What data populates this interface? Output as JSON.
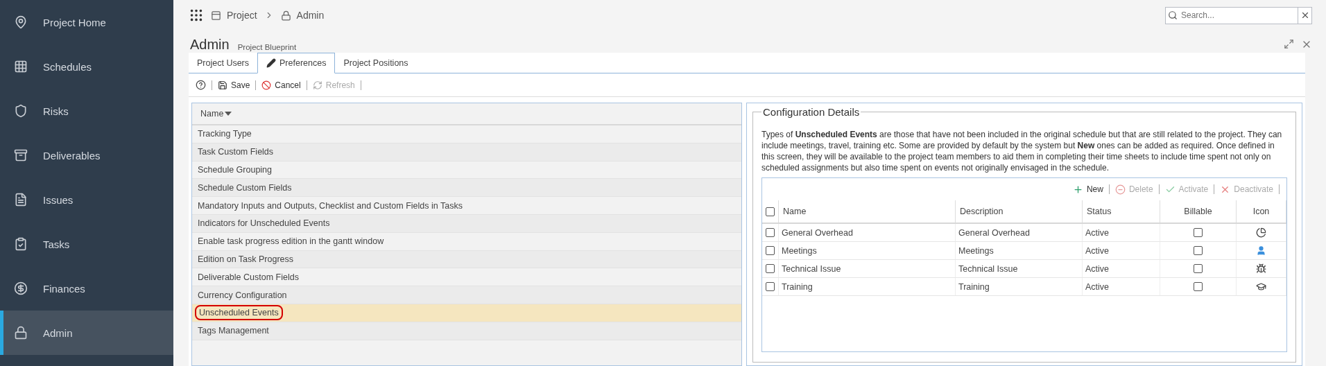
{
  "sidebar": {
    "items": [
      {
        "label": "Project Home",
        "selected": false
      },
      {
        "label": "Schedules",
        "selected": false
      },
      {
        "label": "Risks",
        "selected": false
      },
      {
        "label": "Deliverables",
        "selected": false
      },
      {
        "label": "Issues",
        "selected": false
      },
      {
        "label": "Tasks",
        "selected": false
      },
      {
        "label": "Finances",
        "selected": false
      },
      {
        "label": "Admin",
        "selected": true
      }
    ]
  },
  "breadcrumb": [
    "Project",
    "Admin"
  ],
  "search": {
    "placeholder": "Search..."
  },
  "page": {
    "title": "Admin",
    "subtitle": "Project Blueprint"
  },
  "tabs": [
    {
      "label": "Project Users",
      "selected": false
    },
    {
      "label": "Preferences",
      "selected": true
    },
    {
      "label": "Project Positions",
      "selected": false
    }
  ],
  "toolbar": [
    {
      "label": "Save",
      "disabled": false
    },
    {
      "label": "Cancel",
      "disabled": false
    },
    {
      "label": "Refresh",
      "disabled": true
    }
  ],
  "preferences": {
    "column": "Name",
    "items": [
      {
        "label": "Tracking Type",
        "selected": false,
        "circled": false
      },
      {
        "label": "Task Custom Fields",
        "selected": false,
        "circled": false
      },
      {
        "label": "Schedule Grouping",
        "selected": false,
        "circled": false
      },
      {
        "label": "Schedule Custom Fields",
        "selected": false,
        "circled": false
      },
      {
        "label": "Mandatory Inputs and Outputs, Checklist and Custom Fields in Tasks",
        "selected": false,
        "circled": false
      },
      {
        "label": "Indicators for Unscheduled Events",
        "selected": false,
        "circled": false
      },
      {
        "label": "Enable task progress edition in the gantt window",
        "selected": false,
        "circled": false
      },
      {
        "label": "Edition on Task Progress",
        "selected": false,
        "circled": false
      },
      {
        "label": "Deliverable Custom Fields",
        "selected": false,
        "circled": false
      },
      {
        "label": "Currency Configuration",
        "selected": false,
        "circled": false
      },
      {
        "label": "Unscheduled Events",
        "selected": true,
        "circled": true
      },
      {
        "label": "Tags Management",
        "selected": false,
        "circled": false
      }
    ]
  },
  "details": {
    "title": "Configuration Details",
    "description": "Types of **Unscheduled Events** are those that have not been included in the original schedule but that are still related to the project.  They can include meetings, travel, training etc.  Some are provided by default by the system but **New** ones can be added as required.  Once defined in this screen, they will be available to the project team members to aid them in completing their time sheets to include time spent not only on scheduled assignments but also time spent on events not originally envisaged in the schedule.",
    "actions": [
      {
        "label": "New",
        "disabled": false
      },
      {
        "label": "Delete",
        "disabled": true
      },
      {
        "label": "Activate",
        "disabled": true
      },
      {
        "label": "Deactivate",
        "disabled": true
      }
    ],
    "table": {
      "all_checked": false,
      "columns": [
        "Name",
        "Description",
        "Status",
        "Billable",
        "Icon"
      ],
      "rows": [
        {
          "name": "General Overhead",
          "description": "General Overhead",
          "status": "Active",
          "checked": false,
          "billable": false,
          "kind": "pie"
        },
        {
          "name": "Meetings",
          "description": "Meetings",
          "status": "Active",
          "checked": false,
          "billable": false,
          "kind": "person"
        },
        {
          "name": "Technical Issue",
          "description": "Technical Issue",
          "status": "Active",
          "checked": false,
          "billable": false,
          "kind": "bug"
        },
        {
          "name": "Training",
          "description": "Training",
          "status": "Active",
          "checked": false,
          "billable": false,
          "kind": "cap"
        }
      ]
    }
  }
}
